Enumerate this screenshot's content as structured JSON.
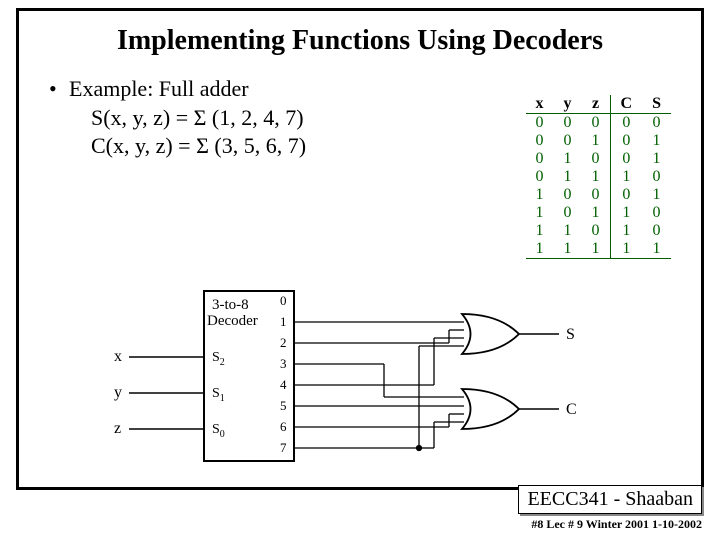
{
  "title": "Implementing Functions Using Decoders",
  "bullet": "Example:  Full adder",
  "line_s": "S(x, y, z) = Σ (1, 2, 4, 7)",
  "line_c": "C(x, y, z) = Σ (3, 5, 6, 7)",
  "truth_table": {
    "headers": [
      "x",
      "y",
      "z",
      "C",
      "S"
    ],
    "rows": [
      [
        "0",
        "0",
        "0",
        "0",
        "0"
      ],
      [
        "0",
        "0",
        "1",
        "0",
        "1"
      ],
      [
        "0",
        "1",
        "0",
        "0",
        "1"
      ],
      [
        "0",
        "1",
        "1",
        "1",
        "0"
      ],
      [
        "1",
        "0",
        "0",
        "0",
        "1"
      ],
      [
        "1",
        "0",
        "1",
        "1",
        "0"
      ],
      [
        "1",
        "1",
        "0",
        "1",
        "0"
      ],
      [
        "1",
        "1",
        "1",
        "1",
        "1"
      ]
    ]
  },
  "diagram": {
    "block_label1": "3-to-8",
    "block_label2": "Decoder",
    "inputs": [
      {
        "var": "x",
        "pin": "S",
        "sub": "2"
      },
      {
        "var": "y",
        "pin": "S",
        "sub": "1"
      },
      {
        "var": "z",
        "pin": "S",
        "sub": "0"
      }
    ],
    "outputs": [
      "0",
      "1",
      "2",
      "3",
      "4",
      "5",
      "6",
      "7"
    ],
    "gate_s": "S",
    "gate_c": "C"
  },
  "footer_box": "EECC341 - Shaaban",
  "footer_line": "#8  Lec # 9   Winter 2001  1-10-2002"
}
